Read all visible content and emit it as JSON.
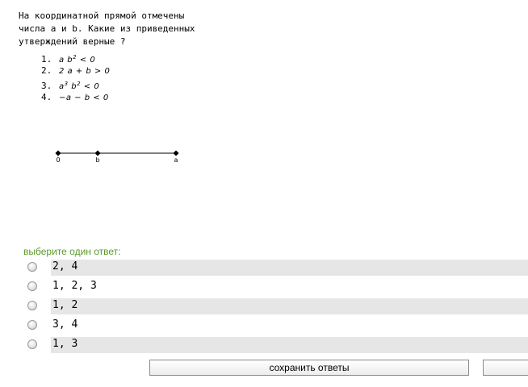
{
  "question": {
    "text": "На координатной прямой отмечены\nчисла a и b. Какие из приведенных\nутверждений верные ?",
    "statements": [
      {
        "num": "1.",
        "parts": [
          "a b",
          "2",
          " < 0"
        ]
      },
      {
        "num": "2.",
        "parts": [
          "2 a + b > 0",
          "",
          ""
        ]
      },
      {
        "num": "3.",
        "parts": [
          "a",
          "3",
          " b"
        ]
      },
      {
        "num": "4.",
        "parts": [
          "−a − b < 0",
          "",
          ""
        ]
      }
    ],
    "statement3_tail": {
      "sup": "2",
      "rest": " < 0"
    }
  },
  "number_line": {
    "labels": {
      "zero": "0",
      "b": "b",
      "a": "a"
    },
    "values": {
      "zero": 0,
      "b": 1,
      "a": 3
    }
  },
  "prompt": "выберите один ответ:",
  "answers": [
    {
      "label": "2, 4",
      "selected": false
    },
    {
      "label": "1, 2, 3",
      "selected": false
    },
    {
      "label": "1, 2",
      "selected": false
    },
    {
      "label": "3, 4",
      "selected": false
    },
    {
      "label": "1, 3",
      "selected": false
    }
  ],
  "save_button": "сохранить ответы",
  "colors": {
    "prompt": "#5a9a2a",
    "row_shade": "#e6e6e6"
  }
}
